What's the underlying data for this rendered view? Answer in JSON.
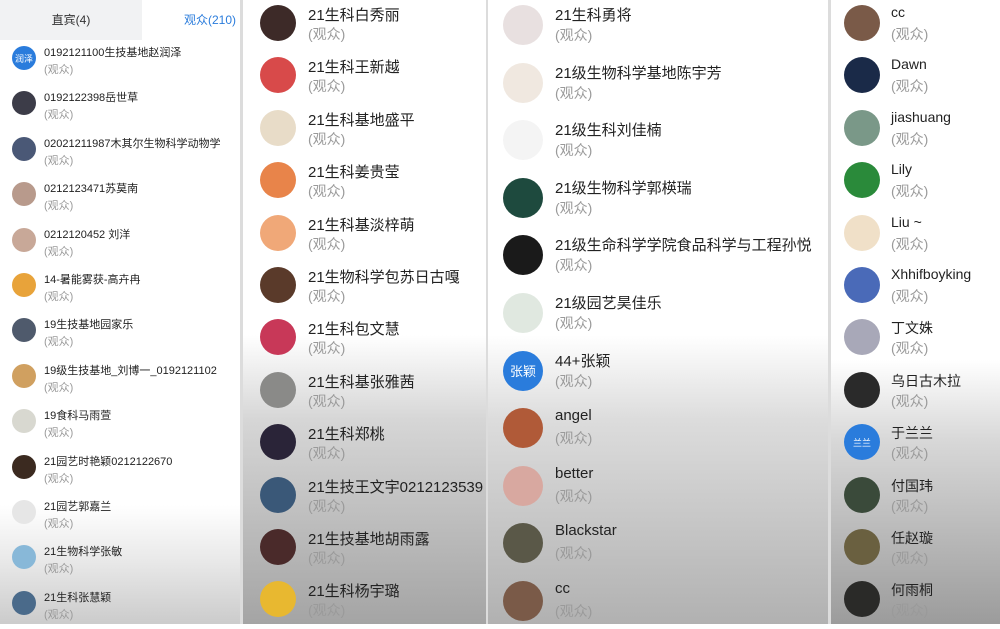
{
  "tabs": {
    "live": "直宾(4)",
    "audience": "观众(210)"
  },
  "role_label": "(观众)",
  "colors": {
    "accent": "#2a7cdc"
  },
  "panel1": [
    {
      "name": "0192121100生技基地赵润泽",
      "avatar_text": "润泽",
      "avatar_color": "#2a7cdc"
    },
    {
      "name": "0192122398岳世草",
      "avatar_color": "#3c3c48"
    },
    {
      "name": "02021211987木其尔生物科学动物学",
      "avatar_color": "#4a5876"
    },
    {
      "name": "0212123471苏莫南",
      "avatar_color": "#b89a8c"
    },
    {
      "name": "0212120452 刘洋",
      "avatar_color": "#c8a898"
    },
    {
      "name": "14-暑能雾获-高卉冉",
      "avatar_color": "#e8a33a"
    },
    {
      "name": "19生技基地园家乐",
      "avatar_color": "#4f5a6c"
    },
    {
      "name": "19级生技基地_刘博一_0192121102",
      "avatar_color": "#d0a060"
    },
    {
      "name": "19食科马雨萱",
      "avatar_color": "#d8d8d0"
    },
    {
      "name": "21园艺时艳颖0212122670",
      "avatar_color": "#3b2a20"
    },
    {
      "name": "21园艺郭嘉兰",
      "avatar_color": "#e6e6e6"
    },
    {
      "name": "21生物科学张敏",
      "avatar_color": "#88b8d8"
    },
    {
      "name": "21生科张慧颖",
      "avatar_color": "#4a6a8a"
    }
  ],
  "panel2": [
    {
      "name": "21生科白秀丽",
      "avatar_color": "#3d2a28"
    },
    {
      "name": "21生科王新越",
      "avatar_color": "#d84a4a"
    },
    {
      "name": "21生科基地盛平",
      "avatar_color": "#e8dcc8"
    },
    {
      "name": "21生科姜贵莹",
      "avatar_color": "#e8844a"
    },
    {
      "name": "21生科基淡梓萌",
      "avatar_color": "#f0a878"
    },
    {
      "name": "21生物科学包苏日古嘎",
      "avatar_color": "#5a3a2a"
    },
    {
      "name": "21生科包文慧",
      "avatar_color": "#c83858"
    },
    {
      "name": "21生科基张雅茜",
      "avatar_color": "#8a8a88"
    },
    {
      "name": "21生科郑桃",
      "avatar_color": "#2a2438"
    },
    {
      "name": "21生技王文宇0212123539",
      "avatar_color": "#3a5878"
    },
    {
      "name": "21生技基地胡雨露",
      "avatar_color": "#4a2a2a"
    },
    {
      "name": "21生科杨宇璐",
      "avatar_color": "#e8b830"
    }
  ],
  "panel3": [
    {
      "name": "21生科勇将",
      "avatar_color": "#e8e0e0"
    },
    {
      "name": "21级生物科学基地陈宇芳",
      "avatar_color": "#f0e8e0"
    },
    {
      "name": "21级生科刘佳楠",
      "avatar_color": "#f4f4f4"
    },
    {
      "name": "21级生物科学郭楧瑞",
      "avatar_color": "#1e4a3e"
    },
    {
      "name": "21级生命科学学院食品科学与工程孙悦",
      "avatar_color": "#1a1a1a"
    },
    {
      "name": "21级园艺昊佳乐",
      "avatar_color": "#e0e8e0"
    },
    {
      "name": "44+张颖",
      "avatar_text": "张颖",
      "avatar_color": "#2a7cdc"
    },
    {
      "name": "angel",
      "avatar_color": "#b05a38"
    },
    {
      "name": "better",
      "avatar_color": "#d8a8a0"
    },
    {
      "name": "Blackstar",
      "avatar_color": "#5a5848"
    },
    {
      "name": "cc",
      "avatar_color": "#7a5a48"
    }
  ],
  "panel4": [
    {
      "name": "cc",
      "avatar_color": "#7a5a48"
    },
    {
      "name": "Dawn",
      "avatar_color": "#1a2a48"
    },
    {
      "name": "jiashuang",
      "avatar_color": "#7a9888"
    },
    {
      "name": "Lily",
      "avatar_color": "#2a8a3a"
    },
    {
      "name": "Liu ~",
      "avatar_color": "#f0e0c8"
    },
    {
      "name": "Xhhifboyking",
      "avatar_color": "#4a6ab8"
    },
    {
      "name": "丁文姝",
      "avatar_color": "#a8a8b8"
    },
    {
      "name": "乌日古木拉",
      "avatar_color": "#2a2a2a"
    },
    {
      "name": "于兰兰",
      "avatar_text": "兰兰",
      "avatar_color": "#2a7cdc"
    },
    {
      "name": "付国玮",
      "avatar_color": "#3a4a3a"
    },
    {
      "name": "任赵璇",
      "avatar_color": "#6a6040"
    },
    {
      "name": "何雨桐",
      "avatar_color": "#2a2a28"
    }
  ]
}
